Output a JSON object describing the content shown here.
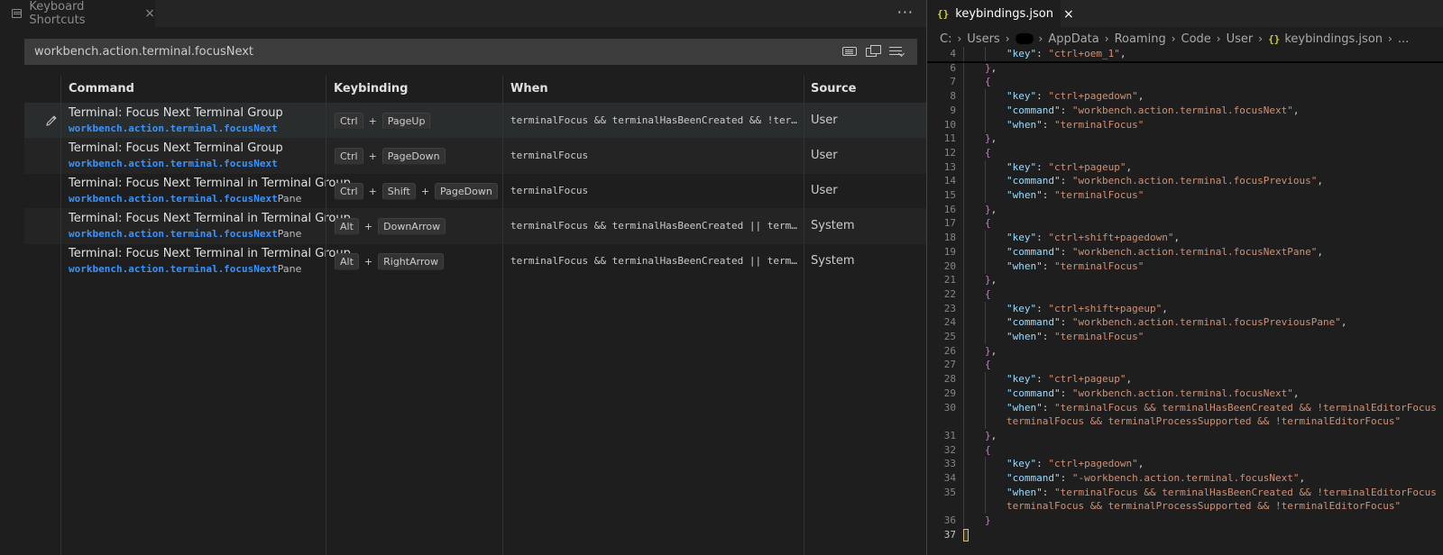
{
  "left_tab": {
    "label": "Keyboard Shortcuts",
    "close": "×"
  },
  "left_more": "···",
  "search": {
    "value": "workbench.action.terminal.focusNext"
  },
  "table": {
    "headers": {
      "command": "Command",
      "keybinding": "Keybinding",
      "when": "When",
      "source": "Source"
    },
    "rows": [
      {
        "title": "Terminal: Focus Next Terminal Group",
        "id_match": "workbench.action.terminal.focusNext",
        "id_rest": "",
        "keys": [
          "Ctrl",
          "PageUp"
        ],
        "when": "terminalFocus && terminalHasBeenCreated && !terminalEditorFocus || terminalFocus && terminalProcessSupported && !terminalEditorFocus",
        "source": "User"
      },
      {
        "title": "Terminal: Focus Next Terminal Group",
        "id_match": "workbench.action.terminal.focusNext",
        "id_rest": "",
        "keys": [
          "Ctrl",
          "PageDown"
        ],
        "when": "terminalFocus",
        "source": "User"
      },
      {
        "title": "Terminal: Focus Next Terminal in Terminal Group",
        "id_match": "workbench.action.terminal.focusNext",
        "id_rest": "Pane",
        "keys": [
          "Ctrl",
          "Shift",
          "PageDown"
        ],
        "when": "terminalFocus",
        "source": "User"
      },
      {
        "title": "Terminal: Focus Next Terminal in Terminal Group",
        "id_match": "workbench.action.terminal.focusNext",
        "id_rest": "Pane",
        "keys": [
          "Alt",
          "DownArrow"
        ],
        "when": "terminalFocus && terminalHasBeenCreated || terminalFocus && terminalProcessSupported",
        "source": "System"
      },
      {
        "title": "Terminal: Focus Next Terminal in Terminal Group",
        "id_match": "workbench.action.terminal.focusNext",
        "id_rest": "Pane",
        "keys": [
          "Alt",
          "RightArrow"
        ],
        "when": "terminalFocus && terminalHasBeenCreated || terminalFocus && terminalProcessSupported",
        "source": "System"
      }
    ],
    "plus": "+"
  },
  "right_tab": {
    "icon": "{}",
    "label": "keybindings.json",
    "close": "×"
  },
  "breadcrumb": [
    "C:",
    "Users",
    "AppData",
    "Roaming",
    "Code",
    "User",
    "keybindings.json",
    "..."
  ],
  "breadcrumb_sep": "›",
  "code_lines": [
    {
      "n": "4",
      "indent": 2,
      "parts": [
        [
          "k",
          "\"key\""
        ],
        [
          "p",
          ": "
        ],
        [
          "s",
          "\"ctrl+oem_1\""
        ],
        [
          "p",
          ","
        ]
      ]
    },
    {
      "n": "6",
      "indent": 1,
      "parts": [
        [
          "b",
          "}"
        ],
        [
          "p",
          ","
        ]
      ]
    },
    {
      "n": "7",
      "indent": 1,
      "parts": [
        [
          "b",
          "{"
        ]
      ]
    },
    {
      "n": "8",
      "indent": 2,
      "parts": [
        [
          "k",
          "\"key\""
        ],
        [
          "p",
          ": "
        ],
        [
          "s",
          "\"ctrl+pagedown\""
        ],
        [
          "p",
          ","
        ]
      ]
    },
    {
      "n": "9",
      "indent": 2,
      "parts": [
        [
          "k",
          "\"command\""
        ],
        [
          "p",
          ": "
        ],
        [
          "s",
          "\"workbench.action.terminal.focusNext\""
        ],
        [
          "p",
          ","
        ]
      ]
    },
    {
      "n": "10",
      "indent": 2,
      "parts": [
        [
          "k",
          "\"when\""
        ],
        [
          "p",
          ": "
        ],
        [
          "s",
          "\"terminalFocus\""
        ]
      ]
    },
    {
      "n": "11",
      "indent": 1,
      "parts": [
        [
          "b",
          "}"
        ],
        [
          "p",
          ","
        ]
      ]
    },
    {
      "n": "12",
      "indent": 1,
      "parts": [
        [
          "b",
          "{"
        ]
      ]
    },
    {
      "n": "13",
      "indent": 2,
      "parts": [
        [
          "k",
          "\"key\""
        ],
        [
          "p",
          ": "
        ],
        [
          "s",
          "\"ctrl+pageup\""
        ],
        [
          "p",
          ","
        ]
      ]
    },
    {
      "n": "14",
      "indent": 2,
      "parts": [
        [
          "k",
          "\"command\""
        ],
        [
          "p",
          ": "
        ],
        [
          "s",
          "\"workbench.action.terminal.focusPrevious\""
        ],
        [
          "p",
          ","
        ]
      ]
    },
    {
      "n": "15",
      "indent": 2,
      "parts": [
        [
          "k",
          "\"when\""
        ],
        [
          "p",
          ": "
        ],
        [
          "s",
          "\"terminalFocus\""
        ]
      ]
    },
    {
      "n": "16",
      "indent": 1,
      "parts": [
        [
          "b",
          "}"
        ],
        [
          "p",
          ","
        ]
      ]
    },
    {
      "n": "17",
      "indent": 1,
      "parts": [
        [
          "b",
          "{"
        ]
      ]
    },
    {
      "n": "18",
      "indent": 2,
      "parts": [
        [
          "k",
          "\"key\""
        ],
        [
          "p",
          ": "
        ],
        [
          "s",
          "\"ctrl+shift+pagedown\""
        ],
        [
          "p",
          ","
        ]
      ]
    },
    {
      "n": "19",
      "indent": 2,
      "parts": [
        [
          "k",
          "\"command\""
        ],
        [
          "p",
          ": "
        ],
        [
          "s",
          "\"workbench.action.terminal.focusNextPane\""
        ],
        [
          "p",
          ","
        ]
      ]
    },
    {
      "n": "20",
      "indent": 2,
      "parts": [
        [
          "k",
          "\"when\""
        ],
        [
          "p",
          ": "
        ],
        [
          "s",
          "\"terminalFocus\""
        ]
      ]
    },
    {
      "n": "21",
      "indent": 1,
      "parts": [
        [
          "b",
          "}"
        ],
        [
          "p",
          ","
        ]
      ]
    },
    {
      "n": "22",
      "indent": 1,
      "parts": [
        [
          "b",
          "{"
        ]
      ]
    },
    {
      "n": "23",
      "indent": 2,
      "parts": [
        [
          "k",
          "\"key\""
        ],
        [
          "p",
          ": "
        ],
        [
          "s",
          "\"ctrl+shift+pageup\""
        ],
        [
          "p",
          ","
        ]
      ]
    },
    {
      "n": "24",
      "indent": 2,
      "parts": [
        [
          "k",
          "\"command\""
        ],
        [
          "p",
          ": "
        ],
        [
          "s",
          "\"workbench.action.terminal.focusPreviousPane\""
        ],
        [
          "p",
          ","
        ]
      ]
    },
    {
      "n": "25",
      "indent": 2,
      "parts": [
        [
          "k",
          "\"when\""
        ],
        [
          "p",
          ": "
        ],
        [
          "s",
          "\"terminalFocus\""
        ]
      ]
    },
    {
      "n": "26",
      "indent": 1,
      "parts": [
        [
          "b",
          "}"
        ],
        [
          "p",
          ","
        ]
      ]
    },
    {
      "n": "27",
      "indent": 1,
      "parts": [
        [
          "b",
          "{"
        ]
      ]
    },
    {
      "n": "28",
      "indent": 2,
      "parts": [
        [
          "k",
          "\"key\""
        ],
        [
          "p",
          ": "
        ],
        [
          "s",
          "\"ctrl+pageup\""
        ],
        [
          "p",
          ","
        ]
      ]
    },
    {
      "n": "29",
      "indent": 2,
      "parts": [
        [
          "k",
          "\"command\""
        ],
        [
          "p",
          ": "
        ],
        [
          "s",
          "\"workbench.action.terminal.focusNext\""
        ],
        [
          "p",
          ","
        ]
      ]
    },
    {
      "n": "30",
      "indent": 2,
      "parts": [
        [
          "k",
          "\"when\""
        ],
        [
          "p",
          ": "
        ],
        [
          "s",
          "\"terminalFocus && terminalHasBeenCreated && !terminalEditorFocus ||"
        ]
      ]
    },
    {
      "n": "",
      "indent": 2,
      "parts": [
        [
          "s",
          "terminalFocus && terminalProcessSupported && !terminalEditorFocus\""
        ]
      ]
    },
    {
      "n": "31",
      "indent": 1,
      "parts": [
        [
          "b",
          "}"
        ],
        [
          "p",
          ","
        ]
      ]
    },
    {
      "n": "32",
      "indent": 1,
      "parts": [
        [
          "b",
          "{"
        ]
      ]
    },
    {
      "n": "33",
      "indent": 2,
      "parts": [
        [
          "k",
          "\"key\""
        ],
        [
          "p",
          ": "
        ],
        [
          "s",
          "\"ctrl+pagedown\""
        ],
        [
          "p",
          ","
        ]
      ]
    },
    {
      "n": "34",
      "indent": 2,
      "parts": [
        [
          "k",
          "\"command\""
        ],
        [
          "p",
          ": "
        ],
        [
          "s",
          "\"-workbench.action.terminal.focusNext\""
        ],
        [
          "p",
          ","
        ]
      ]
    },
    {
      "n": "35",
      "indent": 2,
      "parts": [
        [
          "k",
          "\"when\""
        ],
        [
          "p",
          ": "
        ],
        [
          "s",
          "\"terminalFocus && terminalHasBeenCreated && !terminalEditorFocus ||"
        ]
      ]
    },
    {
      "n": "",
      "indent": 2,
      "parts": [
        [
          "s",
          "terminalFocus && terminalProcessSupported && !terminalEditorFocus\""
        ]
      ]
    },
    {
      "n": "36",
      "indent": 1,
      "parts": [
        [
          "b",
          "}"
        ]
      ]
    },
    {
      "n": "37",
      "indent": 0,
      "parts": [],
      "cursor": true
    }
  ],
  "colors": {
    "match": "#3794ff",
    "json_icon": "#cbcb41",
    "key": "#9cdcfe",
    "string": "#ce9178",
    "bracket": "#da70d6"
  }
}
